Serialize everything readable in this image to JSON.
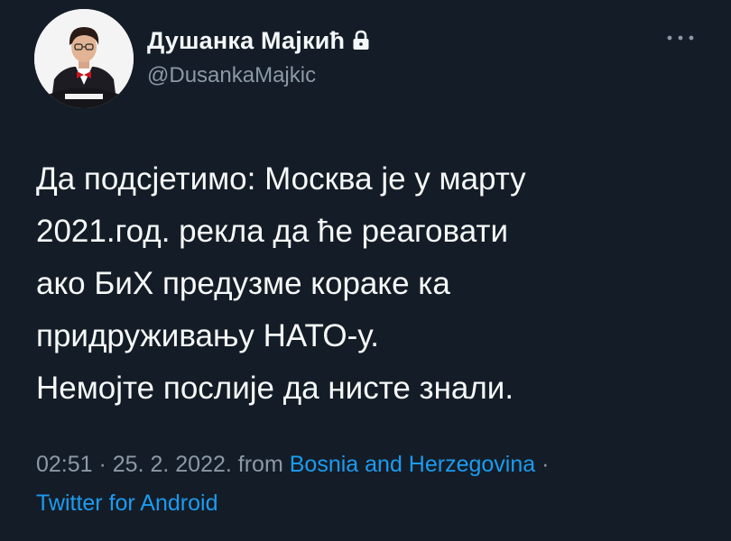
{
  "author": {
    "display_name": "Душанка Мајкић",
    "handle": "@DusankaMajkic",
    "avatar_icon": "user-avatar-photo",
    "lock_icon": "lock-icon"
  },
  "more_icon": "more-horizontal-icon",
  "tweet": {
    "lines": [
      "Да подсјетимо: Москва је у марту",
      "2021.год. рекла да ће реаговати",
      "ако БиХ предузме кораке ка",
      "придруживању НАТО-у.",
      "Немојте послије да нисте знали."
    ]
  },
  "meta": {
    "time": "02:51",
    "sep1": " · ",
    "date": "25. 2. 2022.",
    "from_label": " from ",
    "location": "Bosnia and Herzegovina",
    "sep2": " ·",
    "source": "Twitter for Android"
  },
  "colors": {
    "background": "#15202b",
    "text": "#f7f9f9",
    "muted": "#8b98a5",
    "link": "#1d9bf0"
  }
}
